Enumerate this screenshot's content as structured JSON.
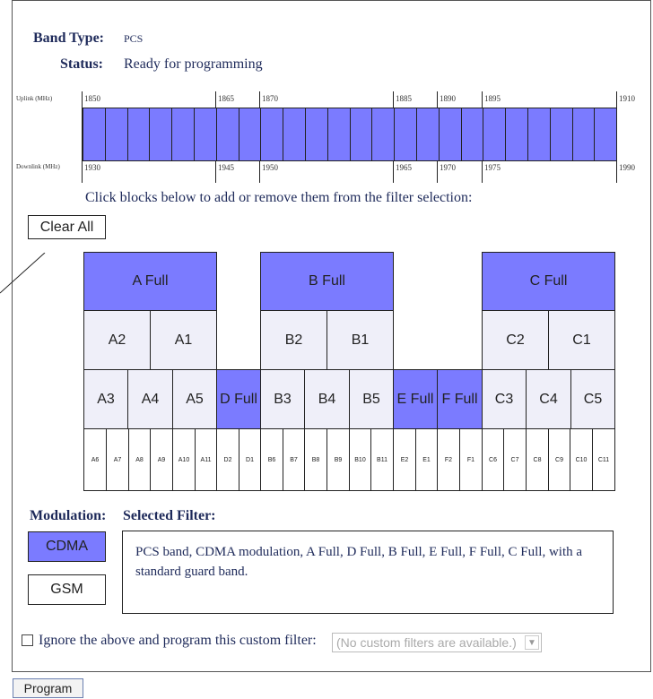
{
  "header": {
    "band_type_label": "Band Type:",
    "band_type_value": "PCS",
    "status_label": "Status:",
    "status_value": "Ready for programming"
  },
  "spectrum": {
    "uplink_label": "Uplink (MHz)",
    "downlink_label": "Downlink (MHz)",
    "uplink_ticks": [
      "1850",
      "1865",
      "1870",
      "1885",
      "1890",
      "1895",
      "1910"
    ],
    "downlink_ticks": [
      "1930",
      "1945",
      "1950",
      "1965",
      "1970",
      "1975",
      "1990"
    ]
  },
  "hint": "Click blocks below to add or remove them from the filter selection:",
  "clear_all": "Clear All",
  "blocks": {
    "a_full": "A Full",
    "b_full": "B Full",
    "c_full": "C Full",
    "a2": "A2",
    "a1": "A1",
    "b2": "B2",
    "b1": "B1",
    "c2": "C2",
    "c1": "C1",
    "a3": "A3",
    "a4": "A4",
    "a5": "A5",
    "d_full": "D Full",
    "b3": "B3",
    "b4": "B4",
    "b5": "B5",
    "e_full": "E Full",
    "f_full": "F Full",
    "c3": "C3",
    "c4": "C4",
    "c5": "C5",
    "tiny": [
      "A6",
      "A7",
      "A8",
      "A9",
      "A10",
      "A11",
      "D2",
      "D1",
      "B6",
      "B7",
      "B8",
      "B9",
      "B10",
      "B11",
      "E2",
      "E1",
      "F2",
      "F1",
      "C6",
      "C7",
      "C8",
      "C9",
      "C10",
      "C11"
    ]
  },
  "modulation": {
    "label": "Modulation:",
    "cdma": "CDMA",
    "gsm": "GSM",
    "selected": "CDMA"
  },
  "selected_filter": {
    "label": "Selected Filter:",
    "text": "PCS band, CDMA modulation, A Full, D Full, B Full, E Full, F Full, C Full, with a standard guard band."
  },
  "custom": {
    "checkbox_label": "Ignore the above and program this custom filter:",
    "select_value": "(No custom filters are available.)"
  },
  "program_button": "Program",
  "colors": {
    "selected": "#7b7bff",
    "unselected": "#efeff9",
    "text": "#1e2a5a"
  }
}
